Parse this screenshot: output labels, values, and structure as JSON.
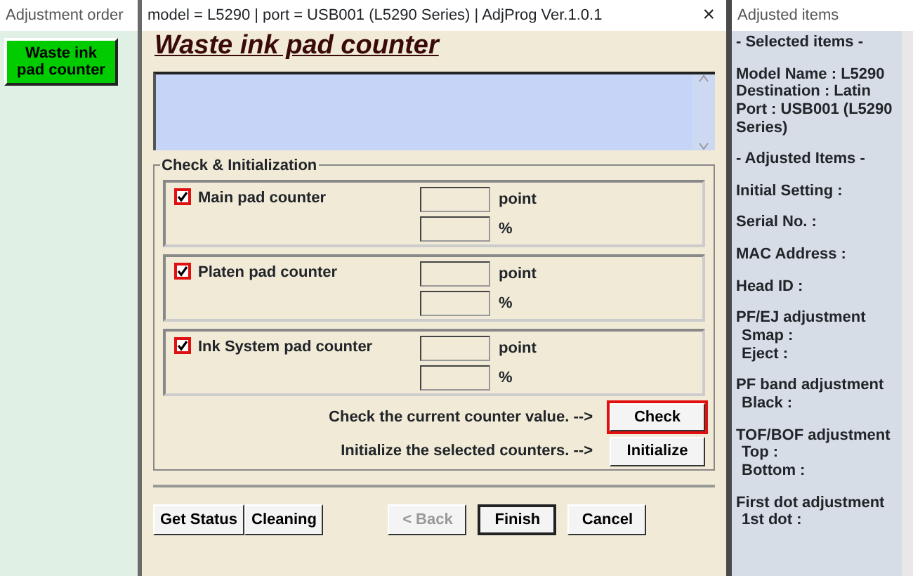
{
  "adjustment_order": {
    "title": "Adjustment order",
    "items": [
      {
        "label": "Waste ink pad counter",
        "selected": true
      }
    ]
  },
  "dialog": {
    "title": "model = L5290 | port = USB001 (L5290 Series) | AdjProg Ver.1.0.1",
    "close": "×",
    "heading": "Waste ink pad counter",
    "group_title": "Check & Initialization",
    "counters": [
      {
        "label": "Main pad counter",
        "checked": true,
        "units": [
          "point",
          "%"
        ]
      },
      {
        "label": "Platen pad counter",
        "checked": true,
        "units": [
          "point",
          "%"
        ]
      },
      {
        "label": "Ink System pad counter",
        "checked": true,
        "units": [
          "point",
          "%"
        ]
      }
    ],
    "actions": [
      {
        "text": "Check the current counter value. -->",
        "button": "Check",
        "highlighted": true
      },
      {
        "text": "Initialize the selected counters. -->",
        "button": "Initialize",
        "highlighted": false
      }
    ],
    "left_buttons": [
      {
        "label": "Get Status",
        "disabled": false,
        "default": false
      },
      {
        "label": "Cleaning",
        "disabled": false,
        "default": false
      }
    ],
    "nav_buttons": [
      {
        "label": "< Back",
        "disabled": true,
        "default": false
      },
      {
        "label": "Finish",
        "disabled": false,
        "default": true
      },
      {
        "label": "Cancel",
        "disabled": false,
        "default": false
      }
    ]
  },
  "adjusted_items": {
    "title": "Adjusted items",
    "groups": [
      [
        {
          "text": "- Selected items -",
          "kind": "main"
        }
      ],
      [
        {
          "text": "Model Name : L5290",
          "kind": "main"
        },
        {
          "text": "Destination : Latin",
          "kind": "main"
        },
        {
          "text": "Port : USB001 (L5290 Series)",
          "kind": "main"
        }
      ],
      [
        {
          "text": "- Adjusted Items -",
          "kind": "main"
        }
      ],
      [
        {
          "text": "Initial Setting :",
          "kind": "main"
        }
      ],
      [
        {
          "text": "Serial No. :",
          "kind": "main"
        }
      ],
      [
        {
          "text": "MAC Address :",
          "kind": "main"
        }
      ],
      [
        {
          "text": "Head ID :",
          "kind": "main"
        }
      ],
      [
        {
          "text": "PF/EJ adjustment",
          "kind": "main"
        },
        {
          "text": "Smap :",
          "kind": "sub"
        },
        {
          "text": "Eject :",
          "kind": "sub"
        }
      ],
      [
        {
          "text": "PF band adjustment",
          "kind": "main"
        },
        {
          "text": "Black :",
          "kind": "sub"
        }
      ],
      [
        {
          "text": "TOF/BOF adjustment",
          "kind": "main"
        },
        {
          "text": "Top :",
          "kind": "sub"
        },
        {
          "text": "Bottom :",
          "kind": "sub"
        }
      ],
      [
        {
          "text": "First dot adjustment",
          "kind": "main"
        },
        {
          "text": "1st dot :",
          "kind": "sub"
        }
      ]
    ]
  }
}
